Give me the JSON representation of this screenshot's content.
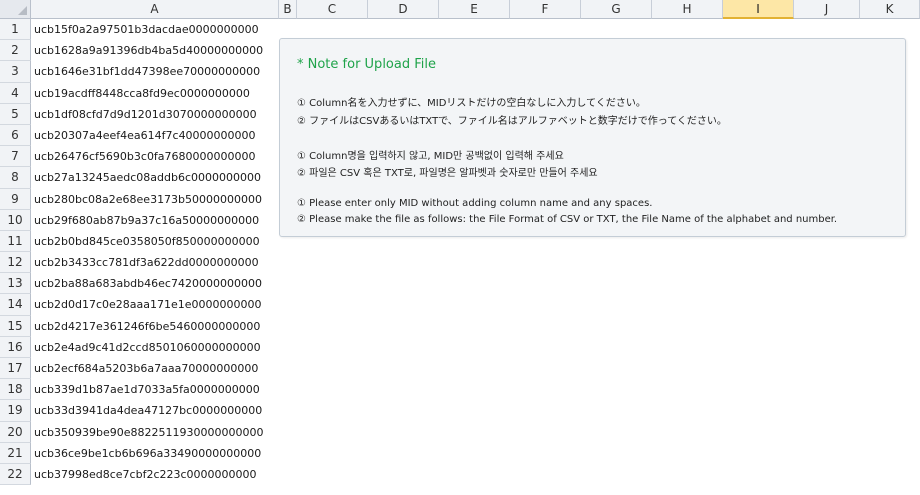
{
  "columns": [
    "A",
    "B",
    "C",
    "D",
    "E",
    "F",
    "G",
    "H",
    "I",
    "J",
    "K"
  ],
  "selected_column": "I",
  "rows": [
    {
      "num": "1",
      "a": "ucb15f0a2a97501b3dacdae0000000000"
    },
    {
      "num": "2",
      "a": "ucb1628a9a91396db4ba5d40000000000"
    },
    {
      "num": "3",
      "a": "ucb1646e31bf1dd47398ee70000000000"
    },
    {
      "num": "4",
      "a": "ucb19acdff8448cca8fd9ec0000000000"
    },
    {
      "num": "5",
      "a": "ucb1df08cfd7d9d1201d3070000000000"
    },
    {
      "num": "6",
      "a": "ucb20307a4eef4ea614f7c40000000000"
    },
    {
      "num": "7",
      "a": "ucb26476cf5690b3c0fa7680000000000"
    },
    {
      "num": "8",
      "a": "ucb27a13245aedc08addb6c0000000000"
    },
    {
      "num": "9",
      "a": "ucb280bc08a2e68ee3173b50000000000"
    },
    {
      "num": "10",
      "a": "ucb29f680ab87b9a37c16a50000000000"
    },
    {
      "num": "11",
      "a": "ucb2b0bd845ce0358050f850000000000"
    },
    {
      "num": "12",
      "a": "ucb2b3433cc781df3a622dd0000000000"
    },
    {
      "num": "13",
      "a": "ucb2ba88a683abdb46ec7420000000000"
    },
    {
      "num": "14",
      "a": "ucb2d0d17c0e28aaa171e1e0000000000"
    },
    {
      "num": "15",
      "a": "ucb2d4217e361246f6be5460000000000"
    },
    {
      "num": "16",
      "a": "ucb2e4ad9c41d2ccd8501060000000000"
    },
    {
      "num": "17",
      "a": "ucb2ecf684a5203b6a7aaa70000000000"
    },
    {
      "num": "18",
      "a": "ucb339d1b87ae1d7033a5fa0000000000"
    },
    {
      "num": "19",
      "a": "ucb33d3941da4dea47127bc0000000000"
    },
    {
      "num": "20",
      "a": "ucb350939be90e8822511930000000000"
    },
    {
      "num": "21",
      "a": "ucb36ce9be1cb6b696a33490000000000"
    },
    {
      "num": "22",
      "a": "ucb37998ed8ce7cbf2c223c0000000000"
    }
  ],
  "note": {
    "title": "* Note for Upload File",
    "jp1": "① Column名を入力せずに、MIDリストだけの空白なしに入力してください。",
    "jp2": "② ファイルはCSVあるいはTXTで、ファイル名はアルファベットと数字だけで作ってください。",
    "ko1": "① Column명을 입력하지 않고, MID만 공백없이 입력해 주세요",
    "ko2": "② 파일은 CSV 혹은 TXT로, 파일명은 알파벳과 숫자로만 만들어 주세요",
    "en1": "① Please enter only MID without adding column name and any spaces.",
    "en2": "② Please make the file as follows: the File Format of CSV or TXT, the File Name of the alphabet and number."
  }
}
